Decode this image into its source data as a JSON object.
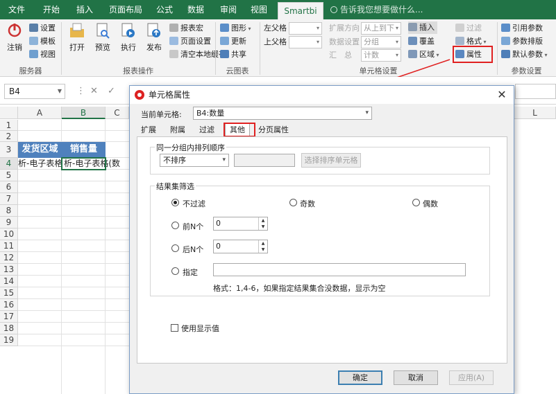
{
  "ribbon_tabs": [
    "文件",
    "开始",
    "插入",
    "页面布局",
    "公式",
    "数据",
    "审阅",
    "视图",
    "Smartbi"
  ],
  "active_tab": "Smartbi",
  "tell_me": "告诉我您想要做什么...",
  "ribbon": {
    "server": {
      "logout": "注销",
      "settings": "设置",
      "template": "模板",
      "view": "视图",
      "group": "服务器"
    },
    "report": {
      "open": "打开",
      "preview": "预览",
      "run": "执行",
      "publish": "发布",
      "macro": "报表宏",
      "page_setup": "页面设置",
      "clear_cache": "清空本地缓存",
      "group": "报表操作"
    },
    "cloud": {
      "graph": "图形",
      "update": "更新",
      "share": "共享",
      "group": "云图表"
    },
    "cell": {
      "left_parent": "左父格",
      "top_parent": "上父格",
      "expand_dir": "扩展方向",
      "expand_dir_value": "从上到下",
      "data_setting": "数据设置",
      "data_setting_value": "分组",
      "summary": "汇　总",
      "summary_value": "计数",
      "insert": "插入",
      "cover": "覆盖",
      "area": "区域",
      "filter": "过滤",
      "format": "格式",
      "property": "属性",
      "group": "单元格设置"
    },
    "param": {
      "ref": "引用参数",
      "sort": "参数排版",
      "default": "默认参数",
      "group": "参数设置"
    }
  },
  "namebox": "B4",
  "columns": [
    "A",
    "B",
    "C",
    "L"
  ],
  "rows": [
    "1",
    "2",
    "3",
    "4",
    "5",
    "6",
    "7",
    "8",
    "9",
    "10",
    "11",
    "12",
    "13",
    "14",
    "15",
    "16",
    "17",
    "18",
    "19"
  ],
  "cells": {
    "a3": "发货区域",
    "b3": "销售量",
    "a4": "析-电子表格",
    "b4": "析-电子表格(数"
  },
  "dialog": {
    "title": "单元格属性",
    "current_cell_label": "当前单元格:",
    "current_cell_value": "B4:数量",
    "tabs": [
      "扩展",
      "附属",
      "过滤",
      "其他",
      "分页属性"
    ],
    "active_tab": "其他",
    "sort_group_title": "同一分组内排列顺序",
    "sort_value": "不排序",
    "sort_button": "选择排序单元格",
    "result_group_title": "结果集筛选",
    "radio_none": "不过滤",
    "radio_odd": "奇数",
    "radio_even": "偶数",
    "radio_first": "前N个",
    "radio_last": "后N个",
    "radio_specify": "指定",
    "first_n": "0",
    "last_n": "0",
    "format_hint": "格式：1,4-6，如果指定结果集合没数据，显示为空",
    "use_display_value": "使用显示值",
    "ok": "确定",
    "cancel": "取消",
    "apply": "应用(A)"
  },
  "colors": {
    "excel_green": "#217346",
    "header_blue": "#4f81bd",
    "highlight_red": "#e02020"
  }
}
